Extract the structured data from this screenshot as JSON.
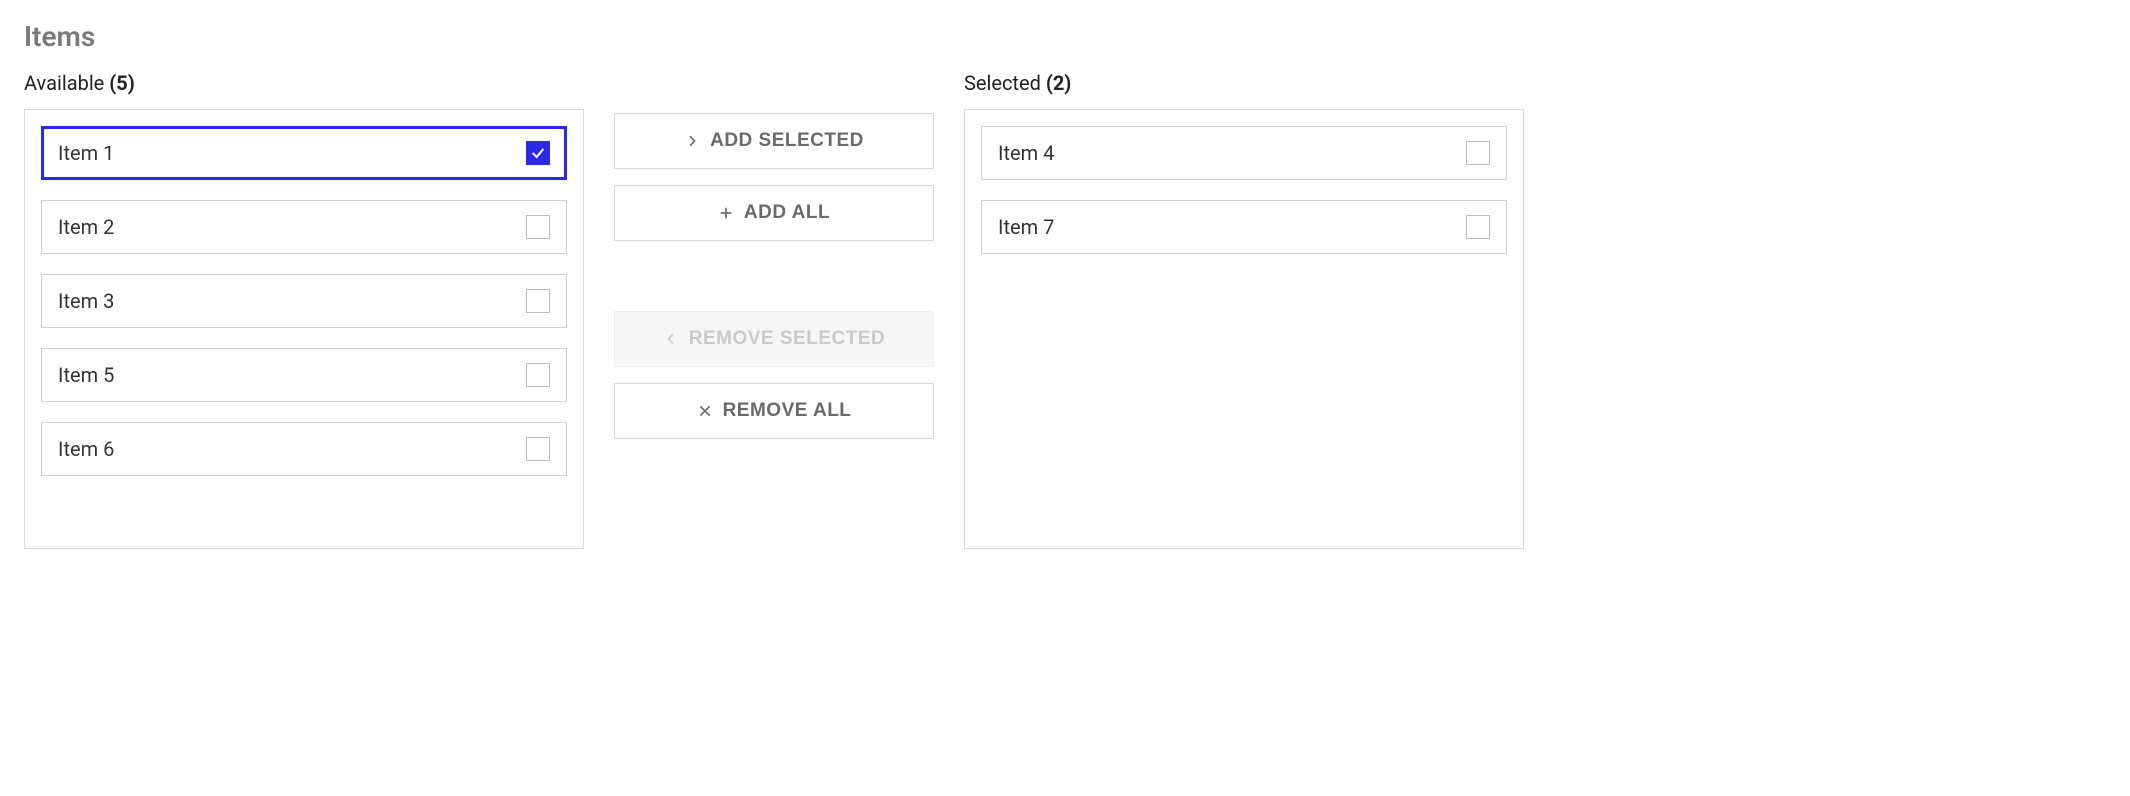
{
  "title": "Items",
  "available": {
    "label": "Available",
    "count": "(5)",
    "items": [
      {
        "label": "Item 1",
        "checked": true,
        "active": true
      },
      {
        "label": "Item 2",
        "checked": false,
        "active": false
      },
      {
        "label": "Item 3",
        "checked": false,
        "active": false
      },
      {
        "label": "Item 5",
        "checked": false,
        "active": false
      },
      {
        "label": "Item 6",
        "checked": false,
        "active": false
      }
    ]
  },
  "selected": {
    "label": "Selected",
    "count": "(2)",
    "items": [
      {
        "label": "Item 4",
        "checked": false,
        "active": false
      },
      {
        "label": "Item 7",
        "checked": false,
        "active": false
      }
    ]
  },
  "actions": {
    "add_selected": "Add Selected",
    "add_all": "Add All",
    "remove_selected": "Remove Selected",
    "remove_all": "Remove All",
    "remove_selected_disabled": true
  }
}
